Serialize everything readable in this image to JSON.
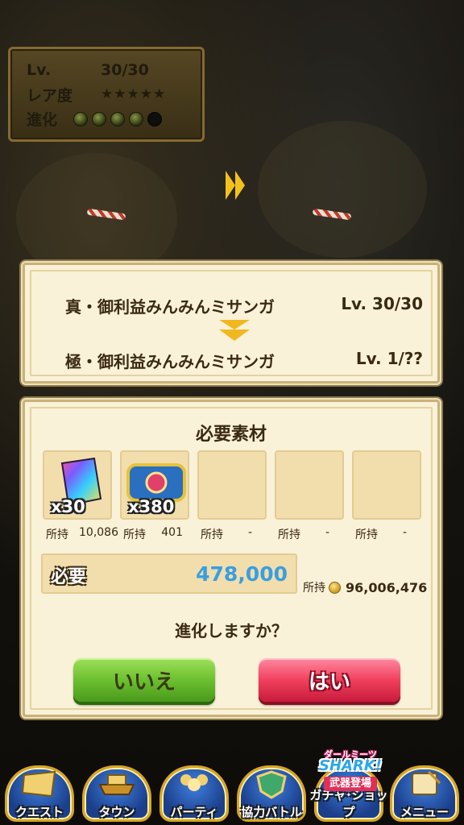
{
  "level_box": {
    "lv_label": "Lv.",
    "lv_value": "30/30",
    "rarity_label": "レア度",
    "rarity_stars": "★★★★★",
    "evolution_label": "進化",
    "evolution_stages": {
      "filled": 4,
      "total": 5
    }
  },
  "evolution": {
    "from_name": "真・御利益みんみんミサンガ",
    "from_level": "Lv. 30/30",
    "to_name": "極・御利益みんみんミサンガ",
    "to_level": "Lv. 1/??"
  },
  "materials": {
    "title": "必要素材",
    "slots": [
      {
        "icon": "rainbow-card-icon",
        "qty": "x30",
        "owned_label": "所持",
        "owned_value": "10,086"
      },
      {
        "icon": "ring-jewel-icon",
        "qty": "x380",
        "owned_label": "所持",
        "owned_value": "401"
      },
      {
        "icon": "",
        "qty": "",
        "owned_label": "所持",
        "owned_value": "-"
      },
      {
        "icon": "",
        "qty": "",
        "owned_label": "所持",
        "owned_value": "-"
      },
      {
        "icon": "",
        "qty": "",
        "owned_label": "所持",
        "owned_value": "-"
      }
    ]
  },
  "cost": {
    "label": "必要",
    "value": "478,000",
    "have_label": "所持",
    "have_value": "96,006,476"
  },
  "confirm": {
    "question": "進化しますか？",
    "no_label": "いいえ",
    "yes_label": "はい"
  },
  "nav": {
    "items": [
      {
        "label": "クエスト"
      },
      {
        "label": "タウン"
      },
      {
        "label": "パーティ"
      },
      {
        "label": "協力バトル"
      },
      {
        "label": "ガチャ･ショップ"
      },
      {
        "label": "メニュー"
      }
    ],
    "banner": {
      "line1": "ダールミーツ",
      "line2": "SHARK!",
      "line3": "武器登場"
    }
  },
  "colors": {
    "panel_bg": "#f9f1d8",
    "cost_value": "#3a9ee0",
    "button_no": "#6cc030",
    "button_yes": "#f0405e"
  }
}
